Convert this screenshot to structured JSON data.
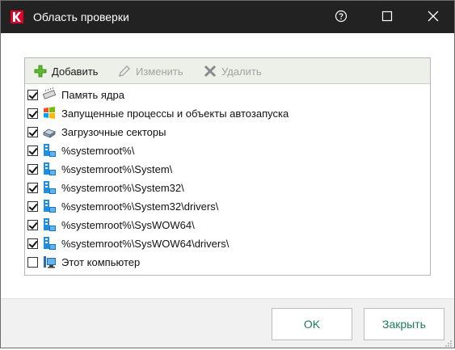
{
  "window": {
    "title": "Область проверки",
    "logo_icon": "kaspersky-k-icon",
    "controls": {
      "help_icon": "help-icon",
      "maximize_icon": "maximize-icon",
      "close_icon": "close-icon"
    }
  },
  "toolbar": {
    "add_label": "Добавить",
    "edit_label": "Изменить",
    "delete_label": "Удалить",
    "add_icon": "plus-icon",
    "edit_icon": "pencil-icon",
    "delete_icon": "cross-icon"
  },
  "items": [
    {
      "label": "Память ядра",
      "checked": true,
      "icon": "memory-chip-icon"
    },
    {
      "label": "Запущенные процессы и объекты автозапуска",
      "checked": true,
      "icon": "windows-logo-icon"
    },
    {
      "label": "Загрузочные секторы",
      "checked": true,
      "icon": "disk-drive-icon"
    },
    {
      "label": "%systemroot%\\",
      "checked": true,
      "icon": "windows-folder-icon"
    },
    {
      "label": "%systemroot%\\System\\",
      "checked": true,
      "icon": "windows-folder-icon"
    },
    {
      "label": "%systemroot%\\System32\\",
      "checked": true,
      "icon": "windows-folder-icon"
    },
    {
      "label": "%systemroot%\\System32\\drivers\\",
      "checked": true,
      "icon": "windows-folder-icon"
    },
    {
      "label": "%systemroot%\\SysWOW64\\",
      "checked": true,
      "icon": "windows-folder-icon"
    },
    {
      "label": "%systemroot%\\SysWOW64\\drivers\\",
      "checked": true,
      "icon": "windows-folder-icon"
    },
    {
      "label": "Этот компьютер",
      "checked": false,
      "icon": "computer-icon"
    }
  ],
  "buttons": {
    "ok_label": "OK",
    "close_label": "Закрыть"
  },
  "colors": {
    "titlebar": "#222222",
    "accent": "#1c7d56",
    "toolbar_bg": "#edf0e8"
  }
}
